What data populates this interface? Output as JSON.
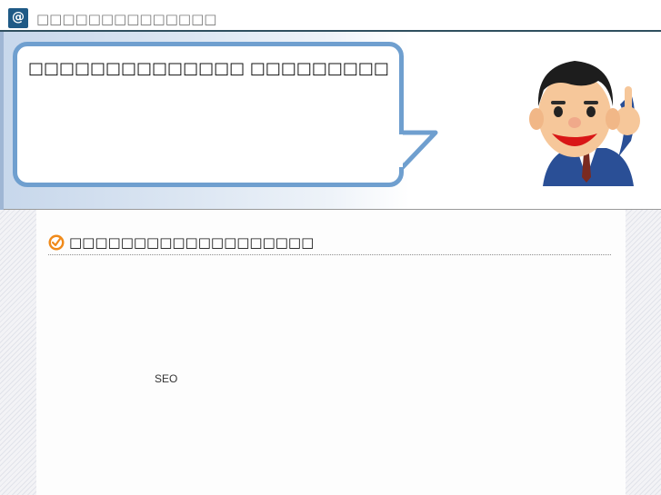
{
  "header": {
    "icon": "at-icon",
    "icon_glyph": "@",
    "site_title": "□□□□□□□□□□□□□□"
  },
  "hero": {
    "speech_text": "□□□□□□□□□□□□□□ □□□□□□□□□",
    "character": "businessman-pointing-illustration"
  },
  "section": {
    "icon": "check-icon",
    "heading": "□□□□□□□□□□□□□□□□□□□"
  },
  "body_text": {
    "seo": "SEO"
  },
  "colors": {
    "header_rule": "#2f4f5f",
    "bubble_border": "#6f9fcf",
    "hero_gradient_start": "#c7d7eb",
    "check_icon": "#f08a1a"
  }
}
